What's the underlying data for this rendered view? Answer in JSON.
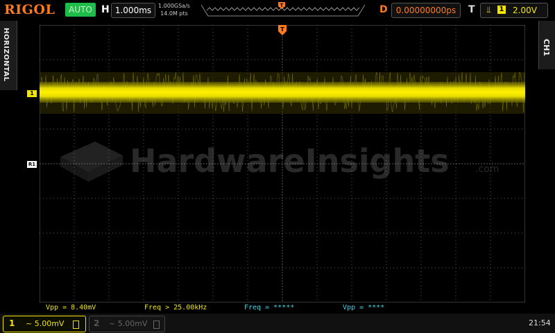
{
  "header": {
    "brand": "RIGOL",
    "run_mode": "AUTO",
    "timebase_label": "H",
    "timebase_value": "1.000ms",
    "sample_rate": "1.000GSa/s",
    "memory_depth": "14.0M pts",
    "delay_label": "D",
    "delay_value": "0.00000000ps",
    "trigger_label": "T",
    "trigger_source": "1",
    "trigger_level": "2.00V"
  },
  "side": {
    "left_tab": "HORIZONTAL",
    "right_tab": "CH1"
  },
  "markers": {
    "ch1_marker": "1",
    "ref_marker": "R1",
    "trigger_marker": "T"
  },
  "watermark": {
    "text": "HardwareInsights",
    "suffix": ".com"
  },
  "measurements": [
    {
      "text": "Vpp = 8.40mV"
    },
    {
      "text": "Freq > 25.00kHz"
    },
    {
      "text": "Freq = *****"
    },
    {
      "text": "Vpp = ****"
    }
  ],
  "channels": {
    "ch1": {
      "number": "1",
      "scale": "~ 5.00mV"
    },
    "ch2": {
      "number": "2",
      "scale": "~ 5.00mV"
    }
  },
  "status": {
    "time": "21:54"
  },
  "colors": {
    "ch1": "#f2e600",
    "accent_orange": "#ff7a1a",
    "auto_green": "#1dbd4a",
    "measure_cyan": "#38d8ee"
  },
  "icons": {
    "trigger_edge": "rising-edge-icon",
    "battery": "battery-icon",
    "trigger_pos": "trigger-position-icon"
  }
}
